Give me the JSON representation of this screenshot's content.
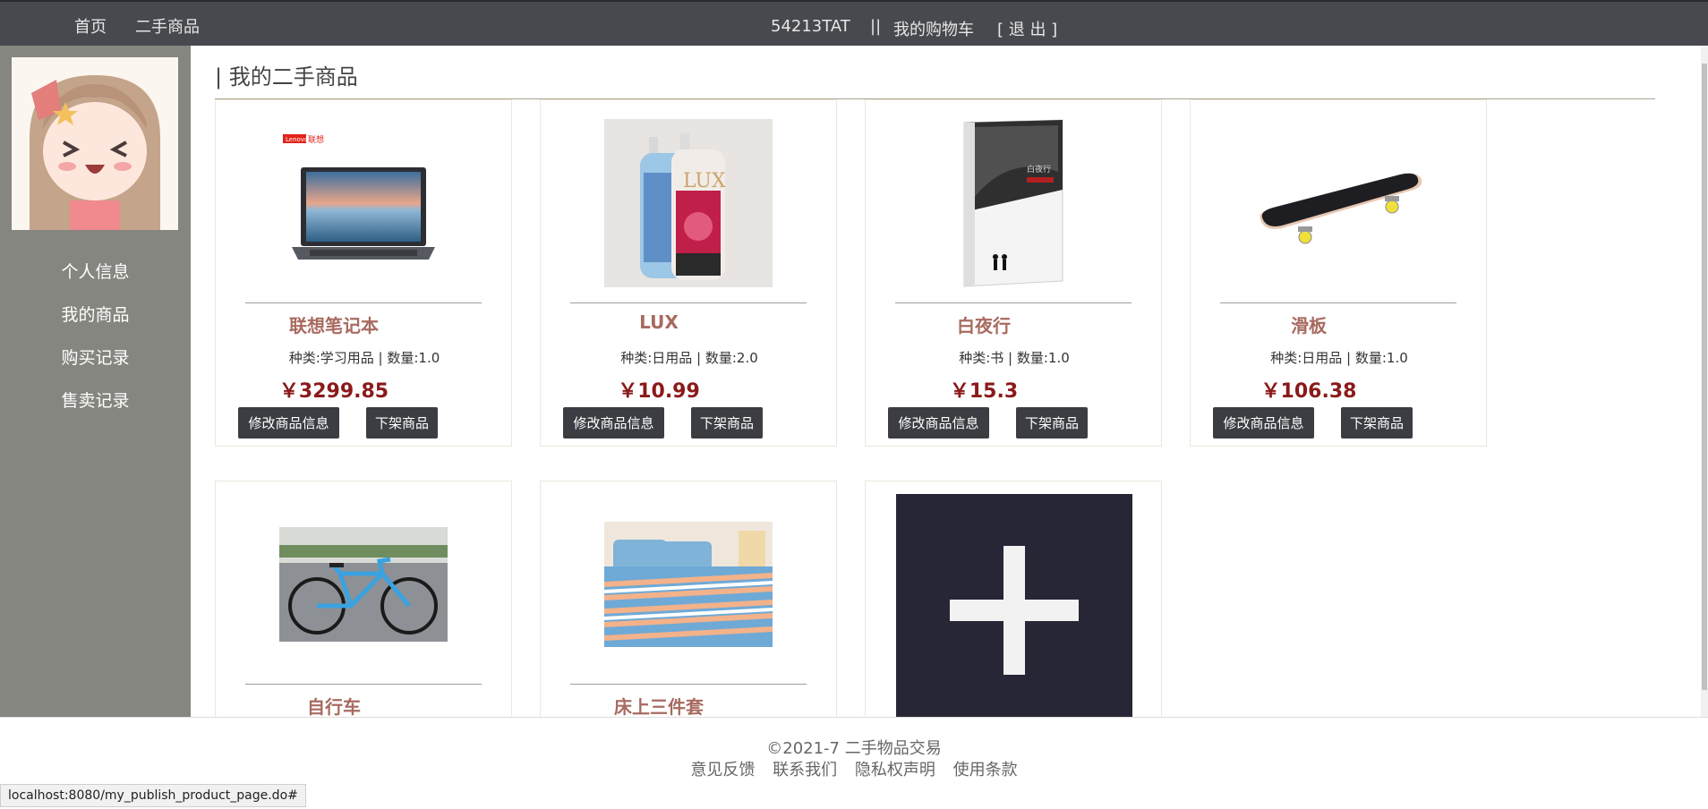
{
  "topnav": {
    "home": "首页",
    "second_hand": "二手商品",
    "username": "54213TAT",
    "separator": "||",
    "cart": "我的购物车",
    "logout": "[ 退 出 ]"
  },
  "sidebar": {
    "items": [
      {
        "label": "个人信息"
      },
      {
        "label": "我的商品"
      },
      {
        "label": "购买记录"
      },
      {
        "label": "售卖记录"
      }
    ]
  },
  "main": {
    "title": "| 我的二手商品",
    "edit_label": "修改商品信息",
    "offline_label": "下架商品",
    "products": [
      {
        "name": "联想笔记本",
        "category": "种类:学习用品 | 数量:1.0",
        "price": "￥3299.85"
      },
      {
        "name": "LUX",
        "category": "种类:日用品 | 数量:2.0",
        "price": "￥10.99"
      },
      {
        "name": "白夜行",
        "category": "种类:书 | 数量:1.0",
        "price": "￥15.3"
      },
      {
        "name": "滑板",
        "category": "种类:日用品 | 数量:1.0",
        "price": "￥106.38"
      },
      {
        "name": "自行车"
      },
      {
        "name": "床上三件套"
      }
    ]
  },
  "footer": {
    "copyright": "©2021-7 二手物品交易",
    "links": [
      "意见反馈",
      "联系我们",
      "隐私权声明",
      "使用条款"
    ]
  },
  "status_url": "localhost:8080/my_publish_product_page.do#",
  "logo_text": "Lenovo联想"
}
